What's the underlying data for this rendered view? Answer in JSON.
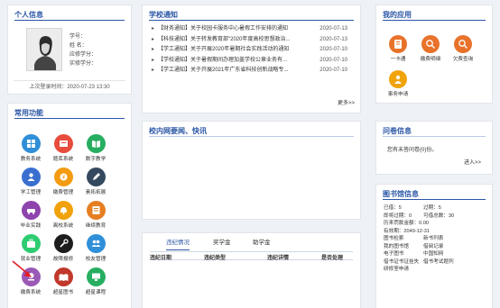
{
  "profile": {
    "title": "个人信息",
    "fields": [
      "学号：",
      "姓  名：",
      "应修学分：",
      "实修学分："
    ],
    "last_login": "上次登录时间：2020-07-23 13:30"
  },
  "common": {
    "title": "常用功能",
    "items": [
      {
        "label": "教务系统",
        "color": "#2f8fd8",
        "icon": "grid-icon"
      },
      {
        "label": "题库系统",
        "color": "#e74c3c",
        "icon": "library-icon"
      },
      {
        "label": "数字教学",
        "color": "#27ae60",
        "icon": "book-icon"
      },
      {
        "label": "学工管理",
        "color": "#3a6fd0",
        "icon": "user-icon"
      },
      {
        "label": "缴费管理",
        "color": "#f39c12",
        "icon": "money-icon"
      },
      {
        "label": "素拓拓展",
        "color": "#34495e",
        "icon": "pencil-icon"
      },
      {
        "label": "毕业实践",
        "color": "#8e44ad",
        "icon": "car-icon"
      },
      {
        "label": "离校系统",
        "color": "#f1a20b",
        "icon": "bell-icon"
      },
      {
        "label": "继续教育",
        "color": "#e67e22",
        "icon": "cert-icon"
      },
      {
        "label": "就业管理",
        "color": "#2ecc71",
        "icon": "bag-icon"
      },
      {
        "label": "故障报修",
        "color": "#1d1d1d",
        "icon": "wrench-icon"
      },
      {
        "label": "校友管理",
        "color": "#2f8fd8",
        "icon": "people-icon"
      },
      {
        "label": "缴费系统",
        "color": "#9b59b6",
        "icon": "pay-icon"
      },
      {
        "label": "超星图书",
        "color": "#c0392b",
        "icon": "open-book-icon"
      },
      {
        "label": "超星课程",
        "color": "#27ae60",
        "icon": "course-icon"
      }
    ]
  },
  "notices": {
    "title": "学校通知",
    "items": [
      {
        "text": "【财务通知】关于校园卡服务中心暑假工作安排的通知",
        "date": "2020-07-13"
      },
      {
        "text": "【科技通知】关于转发教育部\"2020年度高校思想政治...",
        "date": "2020-07-13"
      },
      {
        "text": "【学工通知】关于开展2020年暑期社会实践活动的通知",
        "date": "2020-07-10"
      },
      {
        "text": "【学校通知】关于暑假期间办理加盖学校公章业务有...",
        "date": "2020-07-10"
      },
      {
        "text": "【学工通知】关于开展2021年广东省科技创新战略专...",
        "date": "2020-07-10"
      }
    ],
    "more": "更多>>"
  },
  "news": {
    "title": "校内网要闻、快讯"
  },
  "records": {
    "tabs": [
      "违纪情况",
      "奖学金",
      "助学金"
    ],
    "headers": [
      "违纪日期",
      "违纪类型",
      "违纪详情",
      "是否处理"
    ]
  },
  "apps": {
    "title": "我的应用",
    "items": [
      {
        "label": "一卡通",
        "icon": "card-icon"
      },
      {
        "label": "缴费明细",
        "icon": "detail-icon"
      },
      {
        "label": "欠费查询",
        "icon": "query-icon"
      },
      {
        "label": "事务申请",
        "icon": "apply-icon"
      }
    ]
  },
  "survey": {
    "title": "问卷信息",
    "text": "您有未答问卷(0)份。",
    "enter": "进入>>"
  },
  "library": {
    "title": "图书馆信息",
    "rows": [
      [
        "已借：5",
        "过期：5"
      ],
      [
        "即将过期：0",
        "可借总数：30"
      ],
      [
        "历来罚款金额：0.00",
        ""
      ],
      [
        "有效期：2049-12-31",
        ""
      ],
      [
        "图书检索",
        "新书列表"
      ],
      [
        "我的图书馆",
        "借阅记录"
      ],
      [
        "电子图书",
        "中国知网"
      ],
      [
        "借书证书证挂失",
        "借书考试题列"
      ],
      [
        "研修室申请",
        ""
      ]
    ]
  }
}
